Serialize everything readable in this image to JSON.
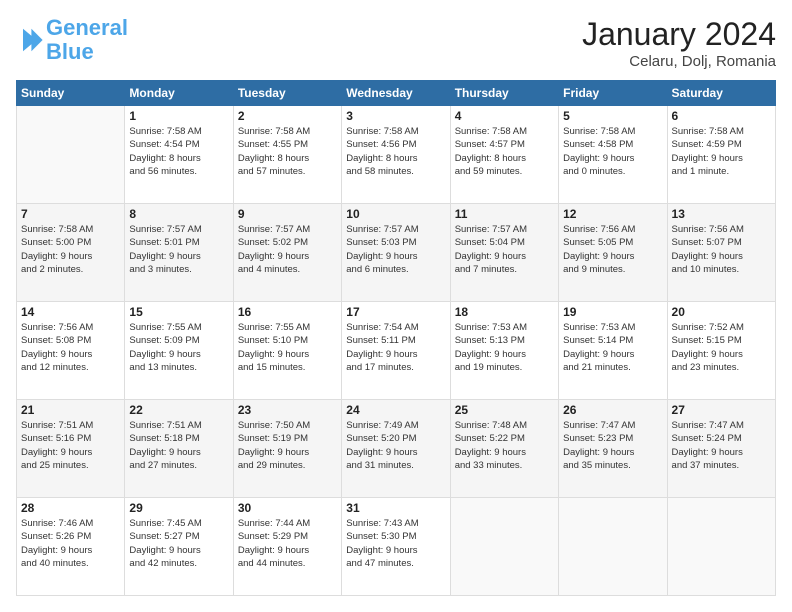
{
  "logo": {
    "line1": "General",
    "line2": "Blue"
  },
  "header": {
    "month": "January 2024",
    "location": "Celaru, Dolj, Romania"
  },
  "weekdays": [
    "Sunday",
    "Monday",
    "Tuesday",
    "Wednesday",
    "Thursday",
    "Friday",
    "Saturday"
  ],
  "weeks": [
    [
      {
        "day": "",
        "info": ""
      },
      {
        "day": "1",
        "info": "Sunrise: 7:58 AM\nSunset: 4:54 PM\nDaylight: 8 hours\nand 56 minutes."
      },
      {
        "day": "2",
        "info": "Sunrise: 7:58 AM\nSunset: 4:55 PM\nDaylight: 8 hours\nand 57 minutes."
      },
      {
        "day": "3",
        "info": "Sunrise: 7:58 AM\nSunset: 4:56 PM\nDaylight: 8 hours\nand 58 minutes."
      },
      {
        "day": "4",
        "info": "Sunrise: 7:58 AM\nSunset: 4:57 PM\nDaylight: 8 hours\nand 59 minutes."
      },
      {
        "day": "5",
        "info": "Sunrise: 7:58 AM\nSunset: 4:58 PM\nDaylight: 9 hours\nand 0 minutes."
      },
      {
        "day": "6",
        "info": "Sunrise: 7:58 AM\nSunset: 4:59 PM\nDaylight: 9 hours\nand 1 minute."
      }
    ],
    [
      {
        "day": "7",
        "info": "Sunrise: 7:58 AM\nSunset: 5:00 PM\nDaylight: 9 hours\nand 2 minutes."
      },
      {
        "day": "8",
        "info": "Sunrise: 7:57 AM\nSunset: 5:01 PM\nDaylight: 9 hours\nand 3 minutes."
      },
      {
        "day": "9",
        "info": "Sunrise: 7:57 AM\nSunset: 5:02 PM\nDaylight: 9 hours\nand 4 minutes."
      },
      {
        "day": "10",
        "info": "Sunrise: 7:57 AM\nSunset: 5:03 PM\nDaylight: 9 hours\nand 6 minutes."
      },
      {
        "day": "11",
        "info": "Sunrise: 7:57 AM\nSunset: 5:04 PM\nDaylight: 9 hours\nand 7 minutes."
      },
      {
        "day": "12",
        "info": "Sunrise: 7:56 AM\nSunset: 5:05 PM\nDaylight: 9 hours\nand 9 minutes."
      },
      {
        "day": "13",
        "info": "Sunrise: 7:56 AM\nSunset: 5:07 PM\nDaylight: 9 hours\nand 10 minutes."
      }
    ],
    [
      {
        "day": "14",
        "info": "Sunrise: 7:56 AM\nSunset: 5:08 PM\nDaylight: 9 hours\nand 12 minutes."
      },
      {
        "day": "15",
        "info": "Sunrise: 7:55 AM\nSunset: 5:09 PM\nDaylight: 9 hours\nand 13 minutes."
      },
      {
        "day": "16",
        "info": "Sunrise: 7:55 AM\nSunset: 5:10 PM\nDaylight: 9 hours\nand 15 minutes."
      },
      {
        "day": "17",
        "info": "Sunrise: 7:54 AM\nSunset: 5:11 PM\nDaylight: 9 hours\nand 17 minutes."
      },
      {
        "day": "18",
        "info": "Sunrise: 7:53 AM\nSunset: 5:13 PM\nDaylight: 9 hours\nand 19 minutes."
      },
      {
        "day": "19",
        "info": "Sunrise: 7:53 AM\nSunset: 5:14 PM\nDaylight: 9 hours\nand 21 minutes."
      },
      {
        "day": "20",
        "info": "Sunrise: 7:52 AM\nSunset: 5:15 PM\nDaylight: 9 hours\nand 23 minutes."
      }
    ],
    [
      {
        "day": "21",
        "info": "Sunrise: 7:51 AM\nSunset: 5:16 PM\nDaylight: 9 hours\nand 25 minutes."
      },
      {
        "day": "22",
        "info": "Sunrise: 7:51 AM\nSunset: 5:18 PM\nDaylight: 9 hours\nand 27 minutes."
      },
      {
        "day": "23",
        "info": "Sunrise: 7:50 AM\nSunset: 5:19 PM\nDaylight: 9 hours\nand 29 minutes."
      },
      {
        "day": "24",
        "info": "Sunrise: 7:49 AM\nSunset: 5:20 PM\nDaylight: 9 hours\nand 31 minutes."
      },
      {
        "day": "25",
        "info": "Sunrise: 7:48 AM\nSunset: 5:22 PM\nDaylight: 9 hours\nand 33 minutes."
      },
      {
        "day": "26",
        "info": "Sunrise: 7:47 AM\nSunset: 5:23 PM\nDaylight: 9 hours\nand 35 minutes."
      },
      {
        "day": "27",
        "info": "Sunrise: 7:47 AM\nSunset: 5:24 PM\nDaylight: 9 hours\nand 37 minutes."
      }
    ],
    [
      {
        "day": "28",
        "info": "Sunrise: 7:46 AM\nSunset: 5:26 PM\nDaylight: 9 hours\nand 40 minutes."
      },
      {
        "day": "29",
        "info": "Sunrise: 7:45 AM\nSunset: 5:27 PM\nDaylight: 9 hours\nand 42 minutes."
      },
      {
        "day": "30",
        "info": "Sunrise: 7:44 AM\nSunset: 5:29 PM\nDaylight: 9 hours\nand 44 minutes."
      },
      {
        "day": "31",
        "info": "Sunrise: 7:43 AM\nSunset: 5:30 PM\nDaylight: 9 hours\nand 47 minutes."
      },
      {
        "day": "",
        "info": ""
      },
      {
        "day": "",
        "info": ""
      },
      {
        "day": "",
        "info": ""
      }
    ]
  ]
}
